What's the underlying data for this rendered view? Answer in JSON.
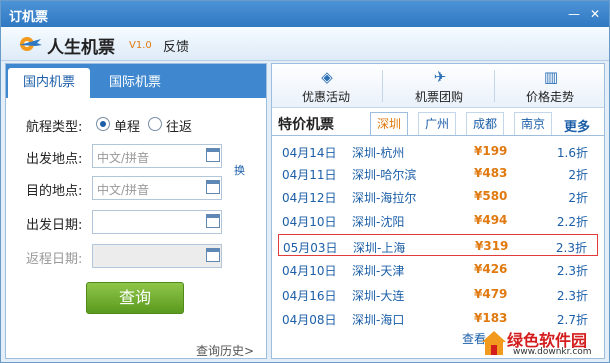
{
  "window": {
    "title": "订机票",
    "min_label": "—",
    "close_label": "✕"
  },
  "brand": {
    "name": "人生机票",
    "version": "V1.0",
    "feedback": "反馈"
  },
  "tabs": [
    {
      "label": "国内机票"
    },
    {
      "label": "国际机票"
    }
  ],
  "form": {
    "trip_type_label": "航程类型:",
    "oneway_label": "单程",
    "roundtrip_label": "往返",
    "depart_city_label": "出发地点:",
    "arrive_city_label": "目的地点:",
    "depart_date_label": "出发日期:",
    "return_date_label": "返程日期:",
    "depart_city_placeholder": "中文/拼音",
    "arrive_city_placeholder": "中文/拼音",
    "swap_label": "换",
    "query_label": "查询",
    "history_label": "查询历史>"
  },
  "tools": [
    {
      "label": "优惠活动",
      "icon": "tag-icon"
    },
    {
      "label": "机票团购",
      "icon": "plane-icon"
    },
    {
      "label": "价格走势",
      "icon": "chart-icon"
    }
  ],
  "deals_title": "特价机票",
  "cities": [
    {
      "label": "深圳"
    },
    {
      "label": "广州"
    },
    {
      "label": "成都"
    },
    {
      "label": "南京"
    }
  ],
  "more_label": "更多",
  "deals": [
    {
      "date": "04月14日",
      "route": "深圳-杭州",
      "price": "¥199",
      "discount": "1.6折"
    },
    {
      "date": "04月11日",
      "route": "深圳-哈尔滨",
      "price": "¥483",
      "discount": "2折"
    },
    {
      "date": "04月12日",
      "route": "深圳-海拉尔",
      "price": "¥580",
      "discount": "2折"
    },
    {
      "date": "04月10日",
      "route": "深圳-沈阳",
      "price": "¥494",
      "discount": "2.2折"
    },
    {
      "date": "05月03日",
      "route": "深圳-上海",
      "price": "¥319",
      "discount": "2.3折"
    },
    {
      "date": "04月10日",
      "route": "深圳-天津",
      "price": "¥426",
      "discount": "2.3折"
    },
    {
      "date": "04月16日",
      "route": "深圳-大连",
      "price": "¥479",
      "discount": "2.3折"
    },
    {
      "date": "04月08日",
      "route": "深圳-海口",
      "price": "¥183",
      "discount": "2.7折"
    }
  ],
  "footer_link": "查看",
  "watermark": {
    "main": "绿色软件园",
    "sub": "www.downkr.com"
  }
}
